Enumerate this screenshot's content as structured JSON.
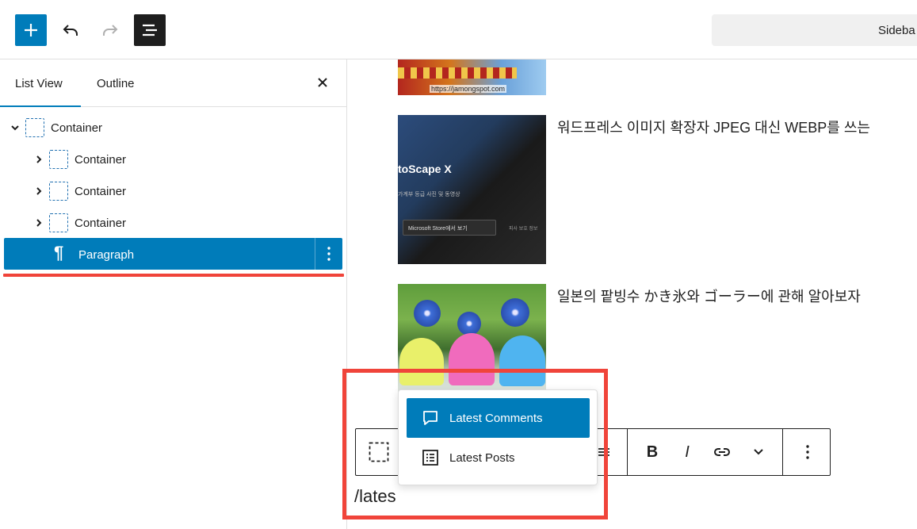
{
  "toolbar": {
    "add_icon": "plus-icon",
    "undo_icon": "undo-icon",
    "redo_icon": "redo-icon",
    "list_view_icon": "list-view-icon",
    "sidebar_label": "Sideba"
  },
  "panel": {
    "tabs": [
      {
        "label": "List View",
        "active": true
      },
      {
        "label": "Outline",
        "active": false
      }
    ],
    "close_icon": "close-icon",
    "tree": [
      {
        "label": "Container",
        "level": 0,
        "expanded": true
      },
      {
        "label": "Container",
        "level": 1,
        "expanded": false
      },
      {
        "label": "Container",
        "level": 1,
        "expanded": false
      },
      {
        "label": "Container",
        "level": 1,
        "expanded": false
      },
      {
        "label": "Paragraph",
        "level": 1,
        "selected": true,
        "icon": "paragraph-icon"
      }
    ]
  },
  "posts": [
    {
      "title": "",
      "thumb_caption": "https://jamongspot.com"
    },
    {
      "title": "워드프레스 이미지 확장자 JPEG 대신 WEBP를 쓰는",
      "thumb_text": "toScape X",
      "thumb_sub": "가계부 등급   사진 및 동영상",
      "thumb_button": "Microsoft Store에서 보기",
      "thumb_extra": "피사 보호 정보"
    },
    {
      "title": "일본의 팥빙수 かき氷와 ゴーラー에 관해 알아보자"
    }
  ],
  "block_toolbar": {
    "bold": "B",
    "italic": "I"
  },
  "editor": {
    "slash_text": "/lates"
  },
  "inserter": {
    "items": [
      {
        "label": "Latest Comments",
        "icon": "comment-icon",
        "active": true
      },
      {
        "label": "Latest Posts",
        "icon": "post-list-icon",
        "active": false
      }
    ]
  },
  "colors": {
    "accent": "#007cba",
    "highlight": "#f0443a",
    "text": "#1e1e1e"
  }
}
